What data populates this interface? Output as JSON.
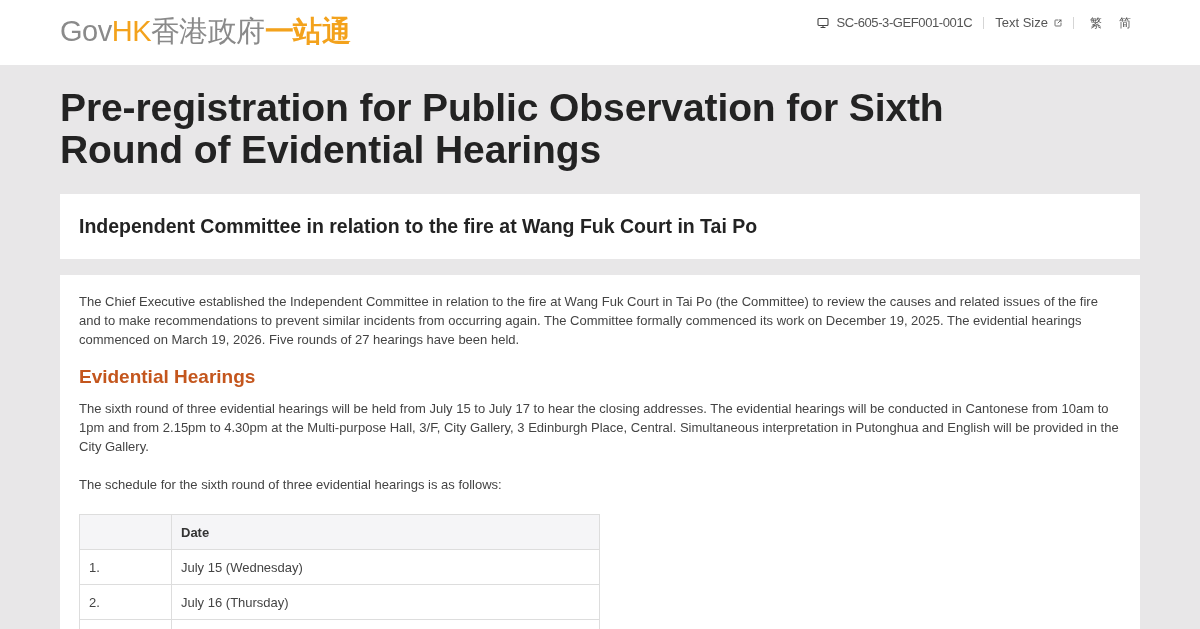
{
  "header": {
    "logo": [
      {
        "text": "Gov",
        "kind": "plain"
      },
      {
        "text": "HK",
        "kind": "accent"
      },
      {
        "text": "香港政府",
        "kind": "plain"
      },
      {
        "text": "一站通",
        "kind": "accent"
      }
    ],
    "page_code": "SC-605-3-GEF001-001C",
    "text_size": "Text Size",
    "languages": [
      "繁",
      "简"
    ]
  },
  "page_title": "Pre-registration for Public Observation for Sixth Round of Evidential Hearings",
  "committee_card": {
    "title": "Independent Committee in relation to the fire at Wang Fuk Court in Tai Po"
  },
  "content": {
    "intro": "The Chief Executive established the Independent Committee in relation to the fire at Wang Fuk Court in Tai Po (the Committee) to review the causes and related issues of the fire and to make recommendations to prevent similar incidents from occurring again. The Committee formally commenced its work on December 19, 2025. The evidential hearings commenced on March 19, 2026. Five rounds of 27 hearings have been held.",
    "section_heading": "Evidential Hearings",
    "paragraphs": [
      "The sixth round of three evidential hearings will be held from July 15 to July 17 to hear the closing addresses. The evidential hearings will be conducted in Cantonese from 10am to 1pm and from 2.15pm to 4.30pm at the Multi-purpose Hall, 3/F, City Gallery, 3 Edinburgh Place, Central. Simultaneous interpretation in Putonghua and English will be provided in the City Gallery.",
      "The schedule for the sixth round of three evidential hearings is as follows:"
    ],
    "table": {
      "date_header": "Date",
      "rows": [
        {
          "number": "1.",
          "date": "July 15 (Wednesday)"
        },
        {
          "number": "2.",
          "date": "July 16 (Thursday)"
        }
      ]
    }
  }
}
